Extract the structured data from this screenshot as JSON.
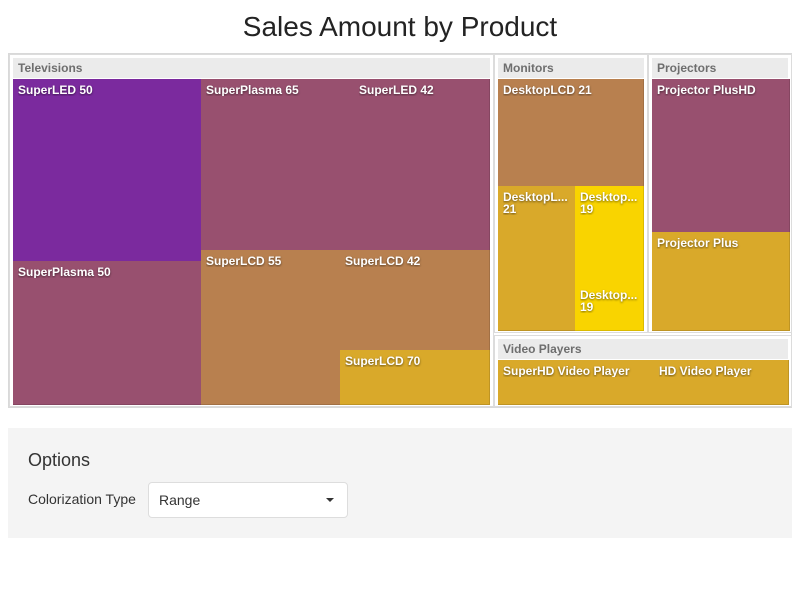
{
  "title": "Sales Amount by Product",
  "colors": {
    "purple": "#7b2a9e",
    "mauve": "#98506f",
    "copper": "#b8804f",
    "gold": "#d9a92a",
    "yellow": "#f9d400"
  },
  "chart_data": {
    "type": "treemap",
    "title": "Sales Amount by Product",
    "groups": [
      {
        "name": "Televisions",
        "items": [
          {
            "label": "SuperLED 50",
            "color": "#7b2a9e"
          },
          {
            "label": "SuperPlasma 65",
            "color": "#98506f"
          },
          {
            "label": "SuperLED 42",
            "color": "#98506f"
          },
          {
            "label": "SuperPlasma 50",
            "color": "#98506f"
          },
          {
            "label": "SuperLCD 55",
            "color": "#b8804f"
          },
          {
            "label": "SuperLCD 42",
            "color": "#b8804f"
          },
          {
            "label": "SuperLCD 70",
            "color": "#d9a92a"
          }
        ]
      },
      {
        "name": "Monitors",
        "items": [
          {
            "label": "DesktopLCD 21",
            "color": "#b8804f"
          },
          {
            "label": "DesktopL...\n21",
            "color": "#d9a92a"
          },
          {
            "label": "Desktop...\n19",
            "color": "#f9d400"
          },
          {
            "label": "Desktop...\n19",
            "color": "#f9d400"
          }
        ]
      },
      {
        "name": "Projectors",
        "items": [
          {
            "label": "Projector PlusHD",
            "color": "#98506f"
          },
          {
            "label": "Projector Plus",
            "color": "#d9a92a"
          }
        ]
      },
      {
        "name": "Video Players",
        "items": [
          {
            "label": "SuperHD Video Player",
            "color": "#d9a92a"
          },
          {
            "label": "HD Video Player",
            "color": "#d9a92a"
          }
        ]
      }
    ]
  },
  "options": {
    "title": "Options",
    "colorization_label": "Colorization Type",
    "colorization_value": "Range",
    "caret_icon": "chevron-down-icon"
  }
}
